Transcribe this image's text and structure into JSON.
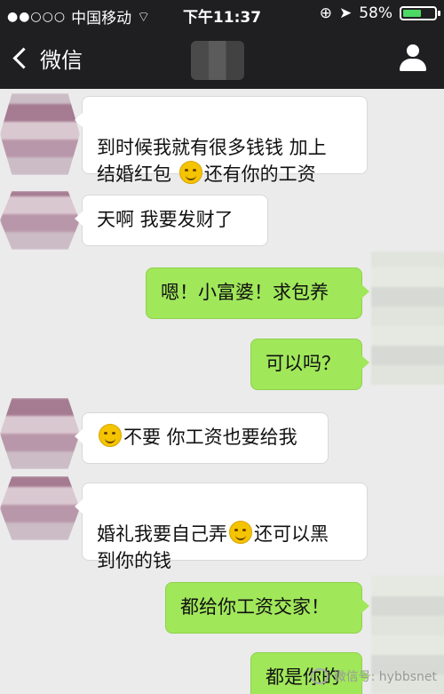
{
  "status": {
    "carrier": "中国移动",
    "time": "下午11:37",
    "battery_percent": "58%",
    "battery_level": 0.58
  },
  "nav": {
    "back_label": "微信"
  },
  "messages": [
    {
      "side": "in",
      "text_parts": [
        "到时候我就有很多钱钱 加上\n结婚红包 ",
        "还有你的工资"
      ]
    },
    {
      "side": "in",
      "text_parts": [
        "天啊 我要发财了"
      ]
    },
    {
      "side": "out",
      "text_parts": [
        "嗯！小富婆！求包养"
      ]
    },
    {
      "side": "out",
      "text_parts": [
        "可以吗？"
      ]
    },
    {
      "side": "in",
      "text_parts": [
        "",
        "不要 你工资也要给我"
      ]
    },
    {
      "side": "in",
      "text_parts": [
        "婚礼我要自己弄",
        "还可以黑\n到你的钱"
      ]
    },
    {
      "side": "out",
      "text_parts": [
        "都给你工资交家！"
      ]
    },
    {
      "side": "out",
      "text_parts": [
        "都是你的"
      ]
    }
  ],
  "watermark": "微信号: hybbsnet",
  "colors": {
    "topbar": "#1f1f22",
    "chat_bg": "#ebebeb",
    "outgoing_bubble": "#a0e75a",
    "incoming_bubble": "#ffffff"
  }
}
